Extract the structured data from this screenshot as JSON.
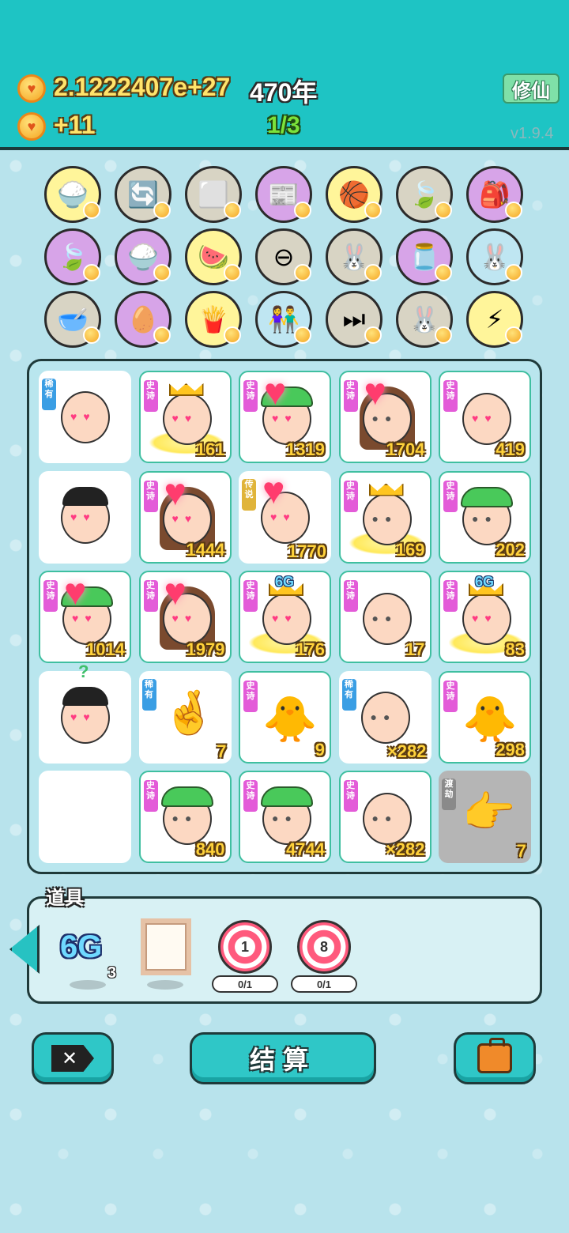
{
  "header": {
    "coins_value": "2.1222407e+27",
    "year_value": "470年",
    "income_value": "+11",
    "progress": "1/3",
    "xiuxian_label": "修仙",
    "version": "v1.9.4"
  },
  "skills": [
    {
      "icon": "rice-bowl-icon",
      "bg": "#fff59a",
      "glyph": "🍚"
    },
    {
      "icon": "refresh-icon",
      "bg": "#d8d4c4",
      "glyph": "🔄"
    },
    {
      "icon": "tofu-blocks-icon",
      "bg": "#d8d4c4",
      "glyph": "⬜"
    },
    {
      "icon": "time-magazine-icon",
      "bg": "#d7a4e8",
      "glyph": "📰"
    },
    {
      "icon": "basketballs-icon",
      "bg": "#fff59a",
      "glyph": "🏀"
    },
    {
      "icon": "leaf-icon",
      "bg": "#d8d4c4",
      "glyph": "🍃"
    },
    {
      "icon": "bag-on-stick-icon",
      "bg": "#d7a4e8",
      "glyph": "🎒"
    },
    {
      "icon": "leaf-icon",
      "bg": "#d7a4e8",
      "glyph": "🍃"
    },
    {
      "icon": "rice-bowl-icon",
      "bg": "#d7a4e8",
      "glyph": "🍚"
    },
    {
      "icon": "fruit-basket-icon",
      "bg": "#fff59a",
      "glyph": "🍉"
    },
    {
      "icon": "minus-icon",
      "bg": "#d8d4c4",
      "glyph": "⊖"
    },
    {
      "icon": "rabbit-icon",
      "bg": "#d8d4c4",
      "glyph": "🐰"
    },
    {
      "icon": "jar-icon",
      "bg": "#d7a4e8",
      "glyph": "🫙"
    },
    {
      "icon": "rabbit-icon",
      "bg": "#bfe6f2",
      "glyph": "🐰"
    },
    {
      "icon": "dog-bowl-icon",
      "bg": "#d8d4c4",
      "glyph": "🥣"
    },
    {
      "icon": "egg-face-icon",
      "bg": "#d7a4e8",
      "glyph": "🥚"
    },
    {
      "icon": "fries-icon",
      "bg": "#fff59a",
      "glyph": "🍟"
    },
    {
      "icon": "couple-icon",
      "bg": "#bfe6f2",
      "glyph": "👫"
    },
    {
      "icon": "skip-icon",
      "bg": "#d8d4c4",
      "glyph": "⏭"
    },
    {
      "icon": "rabbit-icon",
      "bg": "#d8d4c4",
      "glyph": "🐰"
    },
    {
      "icon": "lightning-icon",
      "bg": "#fff59a",
      "glyph": "⚡"
    }
  ],
  "board": {
    "cells": [
      {
        "badge": "稀有",
        "badge_type": "rare",
        "char": "bald-heart-eyes",
        "number": ""
      },
      {
        "badge": "史诗",
        "badge_type": "epic",
        "char": "king-heart-eyes",
        "number": "161"
      },
      {
        "badge": "史诗",
        "badge_type": "epic",
        "char": "green-hat-hearts",
        "number": "1319"
      },
      {
        "badge": "史诗",
        "badge_type": "epic",
        "char": "long-hair-girl",
        "number": "1704"
      },
      {
        "badge": "史诗",
        "badge_type": "epic",
        "char": "bald-heart-eyes",
        "number": "419"
      },
      {
        "badge": "",
        "badge_type": "",
        "char": "dark-hair-heart-eyes",
        "number": ""
      },
      {
        "badge": "史诗",
        "badge_type": "epic",
        "char": "long-hair-hearts",
        "number": "1444"
      },
      {
        "badge": "传说",
        "badge_type": "legend",
        "char": "hearts-cluster",
        "number": "1770"
      },
      {
        "badge": "史诗",
        "badge_type": "epic",
        "char": "king-glasses",
        "number": "169"
      },
      {
        "badge": "史诗",
        "badge_type": "epic",
        "char": "green-hat-glasses",
        "number": "202"
      },
      {
        "badge": "史诗",
        "badge_type": "epic",
        "char": "green-hat-heart",
        "number": "1014"
      },
      {
        "badge": "史诗",
        "badge_type": "epic",
        "char": "long-hair-heart",
        "number": "1979"
      },
      {
        "badge": "史诗",
        "badge_type": "epic",
        "char": "6g-king",
        "number": "176",
        "tag": "6G"
      },
      {
        "badge": "史诗",
        "badge_type": "epic",
        "char": "old-man-ball",
        "number": "17"
      },
      {
        "badge": "史诗",
        "badge_type": "epic",
        "char": "6g-king",
        "number": "83",
        "tag": "6G"
      },
      {
        "badge": "",
        "badge_type": "",
        "char": "mystery-hat",
        "number": ""
      },
      {
        "badge": "稀有",
        "badge_type": "rare",
        "char": "hand-gesture",
        "number": "7"
      },
      {
        "badge": "史诗",
        "badge_type": "epic",
        "char": "chicken-gray-hair",
        "number": "9"
      },
      {
        "badge": "稀有",
        "badge_type": "rare",
        "char": "bald-tired",
        "number": "×282"
      },
      {
        "badge": "史诗",
        "badge_type": "epic",
        "char": "chicken-gray-hair",
        "number": "298"
      },
      {
        "badge": "",
        "badge_type": "",
        "char": "empty",
        "number": ""
      },
      {
        "badge": "史诗",
        "badge_type": "epic",
        "char": "green-hat-glasses",
        "number": "840"
      },
      {
        "badge": "史诗",
        "badge_type": "epic",
        "char": "green-hat-ball",
        "number": "4744"
      },
      {
        "badge": "史诗",
        "badge_type": "epic",
        "char": "bald-glasses",
        "number": "×282"
      },
      {
        "badge": "渡劫",
        "badge_type": "dujie",
        "char": "pointing-hand",
        "number": "7"
      }
    ]
  },
  "items": {
    "title": "道具",
    "g6_label": "6G",
    "g6_count": "3",
    "target1_label": "1",
    "target1_counter": "0/1",
    "target2_label": "8",
    "target2_counter": "0/1"
  },
  "footer": {
    "settle_label": "结算",
    "x_label": "✕"
  }
}
